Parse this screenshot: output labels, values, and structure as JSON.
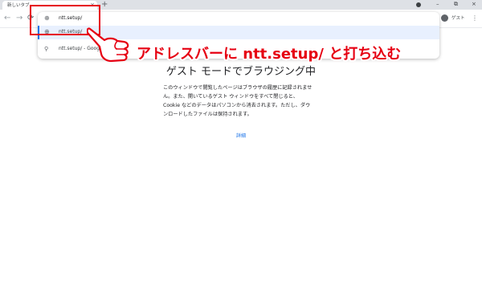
{
  "browser": {
    "tab_title": "新しいタブ",
    "tab_close": "×",
    "new_tab": "+",
    "window_minimize": "–",
    "window_restore": "⧉",
    "window_close": "×",
    "back": "←",
    "forward": "→",
    "reload": "⟳",
    "guest_label": "ゲスト",
    "menu": "⋮"
  },
  "omnibox": {
    "value": "ntt.setup/",
    "suggestions": [
      {
        "text": "ntt.setup/",
        "icon": "globe-icon",
        "selected": true
      },
      {
        "text": "ntt.setup/ - Google",
        "icon": "search-icon",
        "selected": false
      }
    ]
  },
  "page": {
    "heading": "ゲスト モードでブラウジング中",
    "paragraph_lines": [
      "このウィンドウで閲覧したページはブラウザの履歴に記録されませ",
      "ん。また、開いているゲスト ウィンドウをすべて閉じると、",
      "Cookie などのデータはパソコンから消去されます。ただし、ダウ",
      "ンロードしたファイルは保持されます。"
    ],
    "details_link": "詳細"
  },
  "annotation": {
    "callout_text": "アドレスバーに ntt.setup/ と打ち込む",
    "color": "#e60012",
    "pointer_icon": "pointing-hand-icon"
  }
}
